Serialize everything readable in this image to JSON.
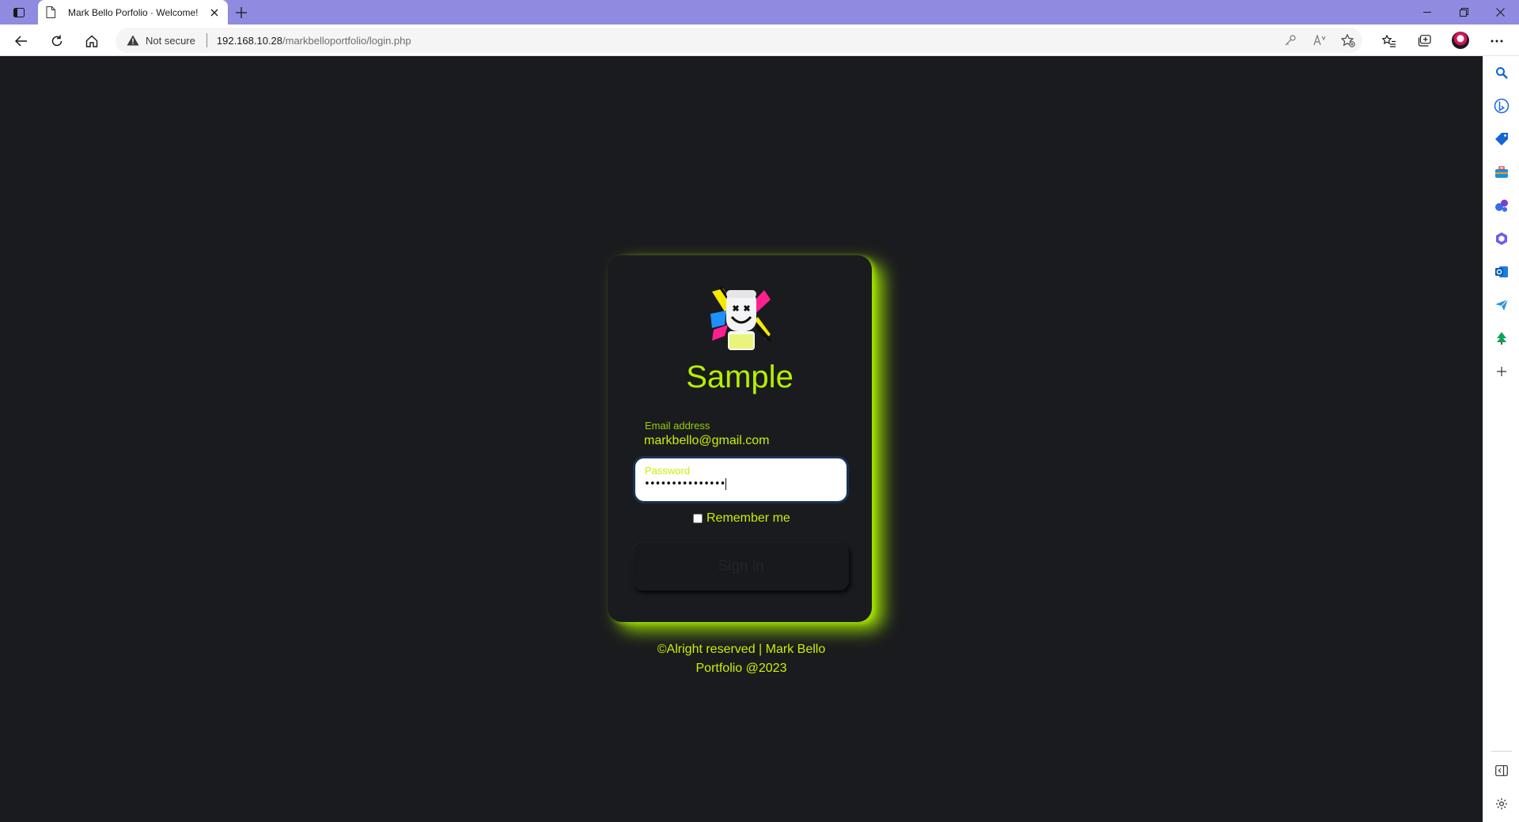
{
  "browser": {
    "tab_title": "Mark Bello Porfolio · Welcome!",
    "security_label": "Not secure",
    "url_host": "192.168.10.28",
    "url_path": "/markbelloportfolio/login.php"
  },
  "login": {
    "title": "Sample",
    "email_label": "Email address",
    "email_value": "markbello@gmail.com",
    "password_label": "Password",
    "password_value": "•••••••••••••••",
    "remember_label": "Remember me",
    "remember_checked": false,
    "signin_label": "Sign in"
  },
  "footer": {
    "line1": "©Alright reserved | Mark Bello",
    "line2": "Portfolio @2023"
  },
  "colors": {
    "accent": "#b5f000",
    "background": "#1a1b1e",
    "titlebar": "#8e8be0"
  }
}
